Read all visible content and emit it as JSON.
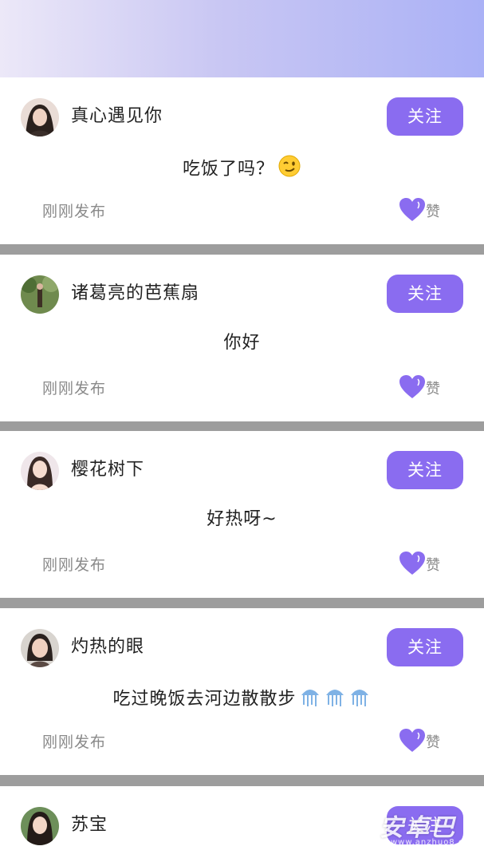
{
  "feed": {
    "posts": [
      {
        "username": "真心遇见你",
        "content": "吃饭了吗？",
        "emoji": "wink-face-icon",
        "time": "刚刚发布",
        "follow_label": "关注",
        "like_label": "赞"
      },
      {
        "username": "诸葛亮的芭蕉扇",
        "content": "你好",
        "emoji": "",
        "time": "刚刚发布",
        "follow_label": "关注",
        "like_label": "赞"
      },
      {
        "username": "樱花树下",
        "content": "好热呀~",
        "emoji": "",
        "time": "刚刚发布",
        "follow_label": "关注",
        "like_label": "赞"
      },
      {
        "username": "灼热的眼",
        "content": "吃过晚饭去河边散散步",
        "emoji": "jellyfish-icon x3",
        "time": "刚刚发布",
        "follow_label": "关注",
        "like_label": "赞"
      },
      {
        "username": "苏宝",
        "follow_label": "关注"
      }
    ]
  },
  "watermark": {
    "text": "安卓巴",
    "url": "www.anzhuo8.com"
  },
  "colors": {
    "accent": "#8a6cf0",
    "separator": "#9d9d9d",
    "header_gradient_end": "#aab1f6"
  }
}
